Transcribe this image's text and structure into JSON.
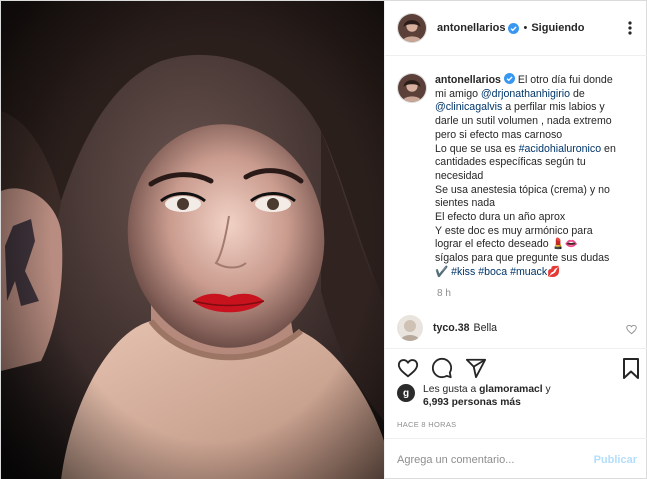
{
  "post": {
    "username": "antonellarios",
    "follow_status": "Siguiendo",
    "separator": "•",
    "caption": {
      "username": "antonellarios",
      "line1": "El otro día fui donde",
      "line2_pre": "mi amigo ",
      "line2_mention": "@drjonathanhigirio",
      "line2_post": " de",
      "line3_mention": "@clinicagalvis",
      "line3_post": " a perfilar mis labios y",
      "line4": "darle un sutil volumen , nada extremo",
      "line5": "pero si efecto mas carnoso",
      "line6_pre": "Lo que se usa es ",
      "line6_tag": "#acidohialuronico",
      "line6_post": " en",
      "line7": "cantidades específicas según tu",
      "line8": "necesidad",
      "line9": "Se usa anestesia tópica (crema) y no",
      "line10": "sientes nada",
      "line11": "El efecto dura un año aprox",
      "line12": "Y este doc es muy armónico para",
      "line13": "lograr el efecto deseado 💄👄",
      "line14": "sígalos para que pregunte sus dudas",
      "line15_pre": "✔️ ",
      "line15_tag1": "#kiss",
      "line15_tag2": "#boca",
      "line15_tag3": "#muack",
      "line15_post": "💋"
    },
    "caption_time": "8 h",
    "comment": {
      "username": "tyco.38",
      "text": "Bella"
    },
    "likes": {
      "avatar_letter": "g",
      "pre": "Les gusta a ",
      "user": "glamoramacl",
      "mid": " y",
      "count": "6,993 personas más"
    },
    "time_ago": "HACE 8 HORAS",
    "comment_input": {
      "placeholder": "Agrega un comentario..."
    },
    "publish_label": "Publicar"
  },
  "icons": {
    "more": "more-options-icon",
    "heart": "heart-icon",
    "comment": "comment-icon",
    "share": "share-icon",
    "save": "bookmark-icon",
    "verified": "verified-badge-icon"
  },
  "colors": {
    "link": "#003569",
    "muted": "#8e8e8e",
    "verified": "#3897f0",
    "publish_disabled": "#b2dffc",
    "border": "#dbdbdb"
  }
}
